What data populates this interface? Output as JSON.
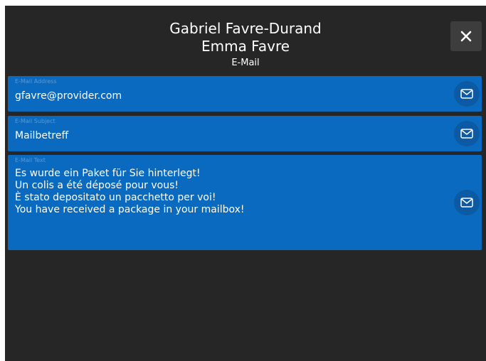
{
  "header": {
    "title_line1": "Gabriel Favre-Durand",
    "title_line2": "Emma Favre",
    "subtitle": "E-Mail",
    "close_icon": "close-icon"
  },
  "fields": {
    "email": {
      "label": "E-Mail Address",
      "value": "gfavre@provider.com",
      "icon": "mail-icon"
    },
    "subject": {
      "label": "E-Mail Subject",
      "value": "Mailbetreff",
      "icon": "mail-icon"
    },
    "text": {
      "label": "E-Mail Text",
      "lines": [
        "Es wurde ein Paket für Sie hinterlegt!",
        "Un colis a été déposé pour vous!",
        "È stato depositato un pacchetto per voi!",
        "You have received a package in your mailbox!"
      ],
      "icon": "mail-icon"
    }
  },
  "colors": {
    "background": "#262626",
    "field": "#0a6abf",
    "button": "#0c5aa3",
    "close_button": "#3d3d3d"
  }
}
